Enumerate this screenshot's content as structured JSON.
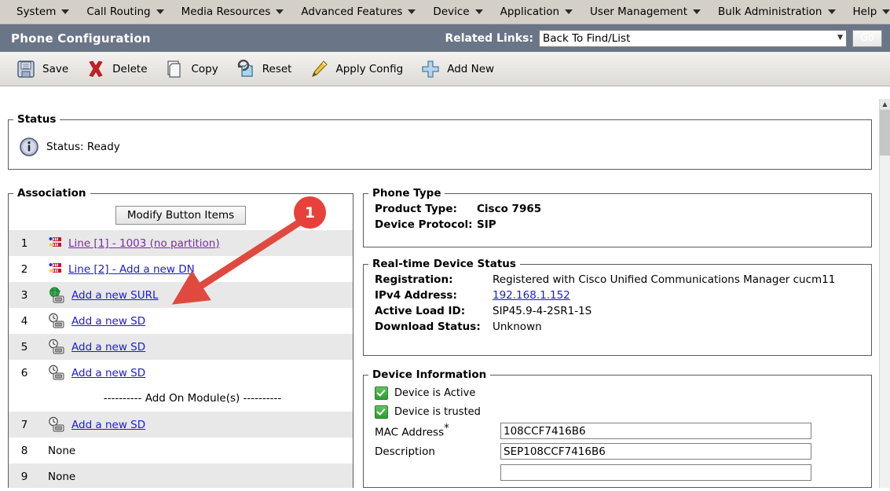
{
  "menu": {
    "items": [
      {
        "label": "System",
        "icon": "chevron-down-icon"
      },
      {
        "label": "Call Routing",
        "icon": "chevron-down-icon"
      },
      {
        "label": "Media Resources",
        "icon": "chevron-down-icon"
      },
      {
        "label": "Advanced Features",
        "icon": "chevron-down-icon"
      },
      {
        "label": "Device",
        "icon": "chevron-down-icon"
      },
      {
        "label": "Application",
        "icon": "chevron-down-icon"
      },
      {
        "label": "User Management",
        "icon": "chevron-down-icon"
      },
      {
        "label": "Bulk Administration",
        "icon": "chevron-down-icon"
      },
      {
        "label": "Help",
        "icon": "chevron-down-icon"
      }
    ]
  },
  "header": {
    "title": "Phone Configuration",
    "related_links_label": "Related Links:",
    "related_links_value": "Back To Find/List",
    "go_label": "Go",
    "bar_color": "#6b7588"
  },
  "toolbar": {
    "buttons": [
      {
        "label": "Save",
        "icon": "save-icon"
      },
      {
        "label": "Delete",
        "icon": "delete-x-icon"
      },
      {
        "label": "Copy",
        "icon": "copy-icon"
      },
      {
        "label": "Reset",
        "icon": "reset-icon"
      },
      {
        "label": "Apply Config",
        "icon": "pencil-icon"
      },
      {
        "label": "Add New",
        "icon": "plus-icon"
      }
    ]
  },
  "status_panel": {
    "legend": "Status",
    "icon": "info-icon",
    "text": "Status: Ready"
  },
  "association": {
    "legend": "Association",
    "modify_button": "Modify Button Items",
    "rows": [
      {
        "num": "1",
        "label": "Line [1] - 1003 (no partition)",
        "icon": "line-icon",
        "link": true,
        "visited": true
      },
      {
        "num": "2",
        "label": "Line [2] - Add a new DN",
        "icon": "line-icon",
        "link": true,
        "visited": false
      },
      {
        "num": "3",
        "label": "Add a new SURL",
        "icon": "globe-phone-icon",
        "link": true,
        "visited": false
      },
      {
        "num": "4",
        "label": "Add a new SD",
        "icon": "speeddial-icon",
        "link": true,
        "visited": false
      },
      {
        "num": "5",
        "label": "Add a new SD",
        "icon": "speeddial-icon",
        "link": true,
        "visited": false
      },
      {
        "num": "6",
        "label": "Add a new SD",
        "icon": "speeddial-icon",
        "link": true,
        "visited": false
      }
    ],
    "addon_separator": "---------- Add On Module(s) ----------",
    "rows2": [
      {
        "num": "7",
        "label": "Add a new SD",
        "icon": "speeddial-icon",
        "link": true,
        "visited": false
      },
      {
        "num": "8",
        "label": "None",
        "icon": "",
        "link": false,
        "visited": false
      },
      {
        "num": "9",
        "label": "None",
        "icon": "",
        "link": false,
        "visited": false
      }
    ]
  },
  "phone_type": {
    "legend": "Phone Type",
    "product_type_label": "Product Type:",
    "product_type_value": "Cisco 7965",
    "device_protocol_label": "Device Protocol:",
    "device_protocol_value": "SIP"
  },
  "realtime_status": {
    "legend": "Real-time Device Status",
    "registration_label": "Registration:",
    "registration_value": "Registered with Cisco Unified Communications Manager cucm11",
    "ipv4_label": "IPv4 Address:",
    "ipv4_value": "192.168.1.152",
    "active_load_label": "Active Load ID:",
    "active_load_value": "SIP45.9-4-2SR1-1S",
    "download_label": "Download Status:",
    "download_value": "Unknown"
  },
  "device_information": {
    "legend": "Device Information",
    "device_active_label": "Device is Active",
    "device_trusted_label": "Device is trusted",
    "mac_label": "MAC Address",
    "mac_value": "108CCF7416B6",
    "description_label": "Description",
    "description_value": "SEP108CCF7416B6"
  },
  "annotation": {
    "badge_number": "1",
    "badge_color": "#e8413c",
    "arrow_color": "#e0493f"
  },
  "scrollbar": {
    "up_arrow": "▲"
  }
}
